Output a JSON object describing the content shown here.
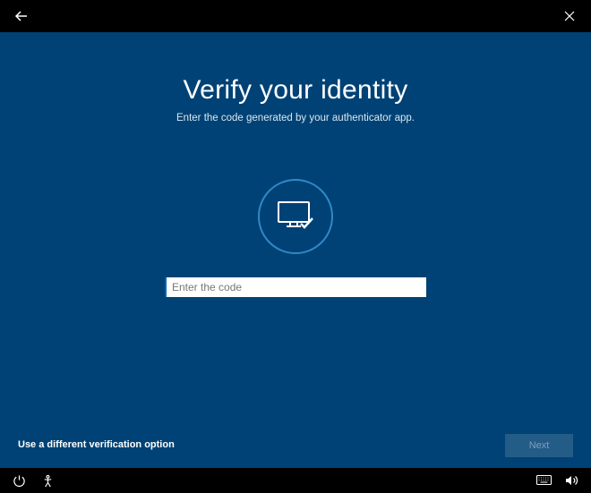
{
  "header": {
    "back_icon": "back",
    "close_icon": "close"
  },
  "main": {
    "title": "Verify your identity",
    "subtitle": "Enter the code generated by your authenticator app.",
    "circle_icon": "monitor-check",
    "code_input": {
      "value": "",
      "placeholder": "Enter the code"
    },
    "alt_option_label": "Use a different verification option",
    "next_label": "Next"
  },
  "footer": {
    "left_icons": [
      "power",
      "accessibility"
    ],
    "right_icons": [
      "keyboard",
      "volume"
    ]
  },
  "colors": {
    "page_bg": "#004275",
    "accent": "#2f89c6"
  }
}
